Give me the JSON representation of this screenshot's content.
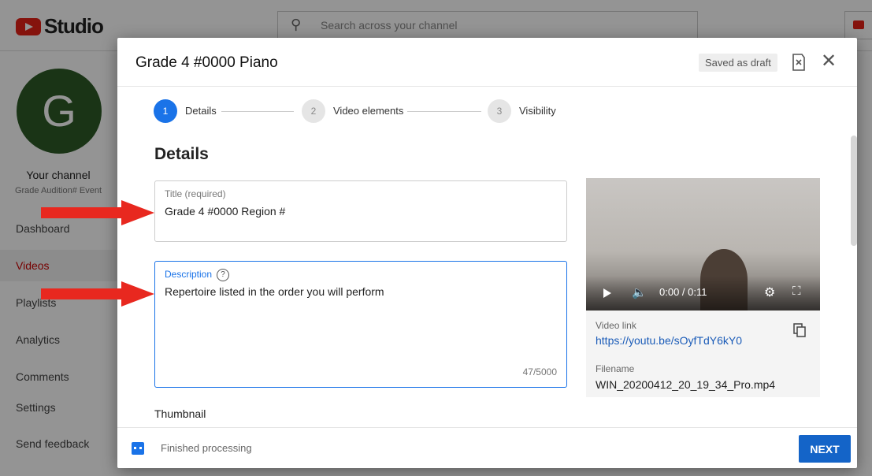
{
  "topbar": {
    "studio_label": "Studio",
    "search_placeholder": "Search across your channel"
  },
  "sidebar": {
    "avatar_letter": "G",
    "channel_name": "Your channel",
    "channel_sub": "Grade Audition# Event",
    "items": [
      {
        "label": "Dashboard"
      },
      {
        "label": "Videos"
      },
      {
        "label": "Playlists"
      },
      {
        "label": "Analytics"
      },
      {
        "label": "Comments"
      },
      {
        "label": "Settings"
      },
      {
        "label": "Send feedback"
      }
    ]
  },
  "dialog": {
    "title": "Grade 4 #0000 Piano",
    "draft_status": "Saved as draft",
    "steps": [
      {
        "num": "1",
        "label": "Details"
      },
      {
        "num": "2",
        "label": "Video elements"
      },
      {
        "num": "3",
        "label": "Visibility"
      }
    ],
    "section_heading": "Details",
    "title_field": {
      "label": "Title (required)",
      "value": "Grade 4  #0000 Region #"
    },
    "description_field": {
      "label": "Description",
      "help": "?",
      "value": "Repertoire listed in the order you will perform",
      "count": "47/5000"
    },
    "thumbnail_heading": "Thumbnail",
    "video": {
      "time": "0:00 / 0:11",
      "link_label": "Video link",
      "link": "https://youtu.be/sOyfTdY6kY0",
      "filename_label": "Filename",
      "filename": "WIN_20200412_20_19_34_Pro.mp4"
    },
    "footer": {
      "status": "Finished processing",
      "next_label": "NEXT"
    }
  },
  "colors": {
    "accent": "#1a73e8",
    "arrow": "#e8281f",
    "next_button": "#1464c8"
  }
}
